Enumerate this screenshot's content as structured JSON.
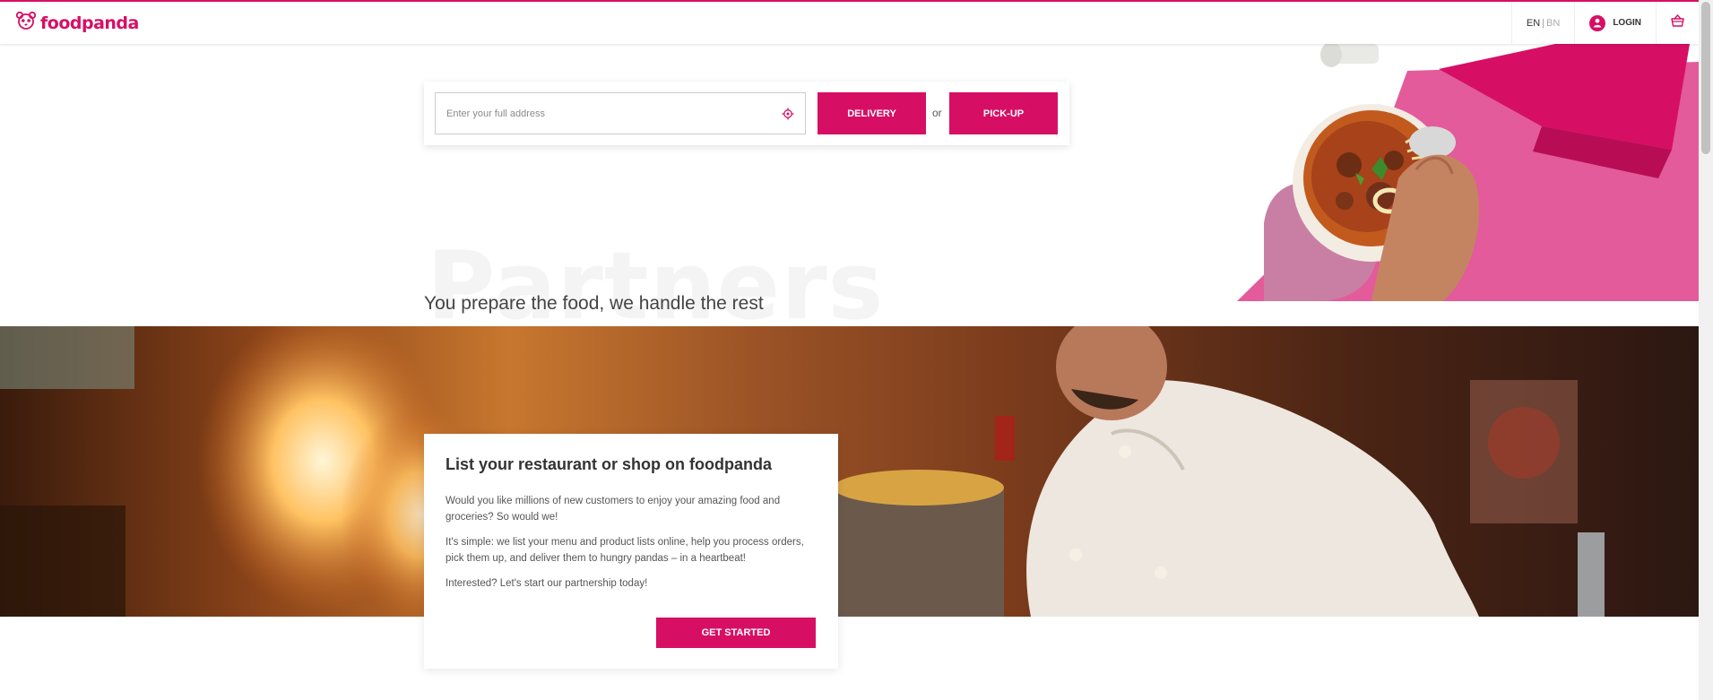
{
  "header": {
    "logo_text": "foodpanda",
    "lang_active": "EN",
    "lang_other": "BN",
    "login_label": "LOGIN"
  },
  "search": {
    "placeholder": "Enter your full address",
    "delivery_label": "DELIVERY",
    "or_label": "or",
    "pickup_label": "PICK-UP"
  },
  "partners": {
    "ghost_title": "Partners",
    "tagline": "You prepare the food, we handle the rest",
    "card": {
      "title": "List your restaurant or shop on foodpanda",
      "p1": "Would you like millions of new customers to enjoy your amazing food and groceries? So would we!",
      "p2": "It's simple: we list your menu and product lists online, help you process orders, pick them up, and deliver them to hungry pandas – in a heartbeat!",
      "p3": "Interested? Let's start our partnership today!",
      "cta": "GET STARTED"
    }
  },
  "colors": {
    "brand": "#d70f64"
  },
  "icons": [
    "panda-logo-icon",
    "location-target-icon",
    "user-icon",
    "shopping-basket-icon"
  ]
}
